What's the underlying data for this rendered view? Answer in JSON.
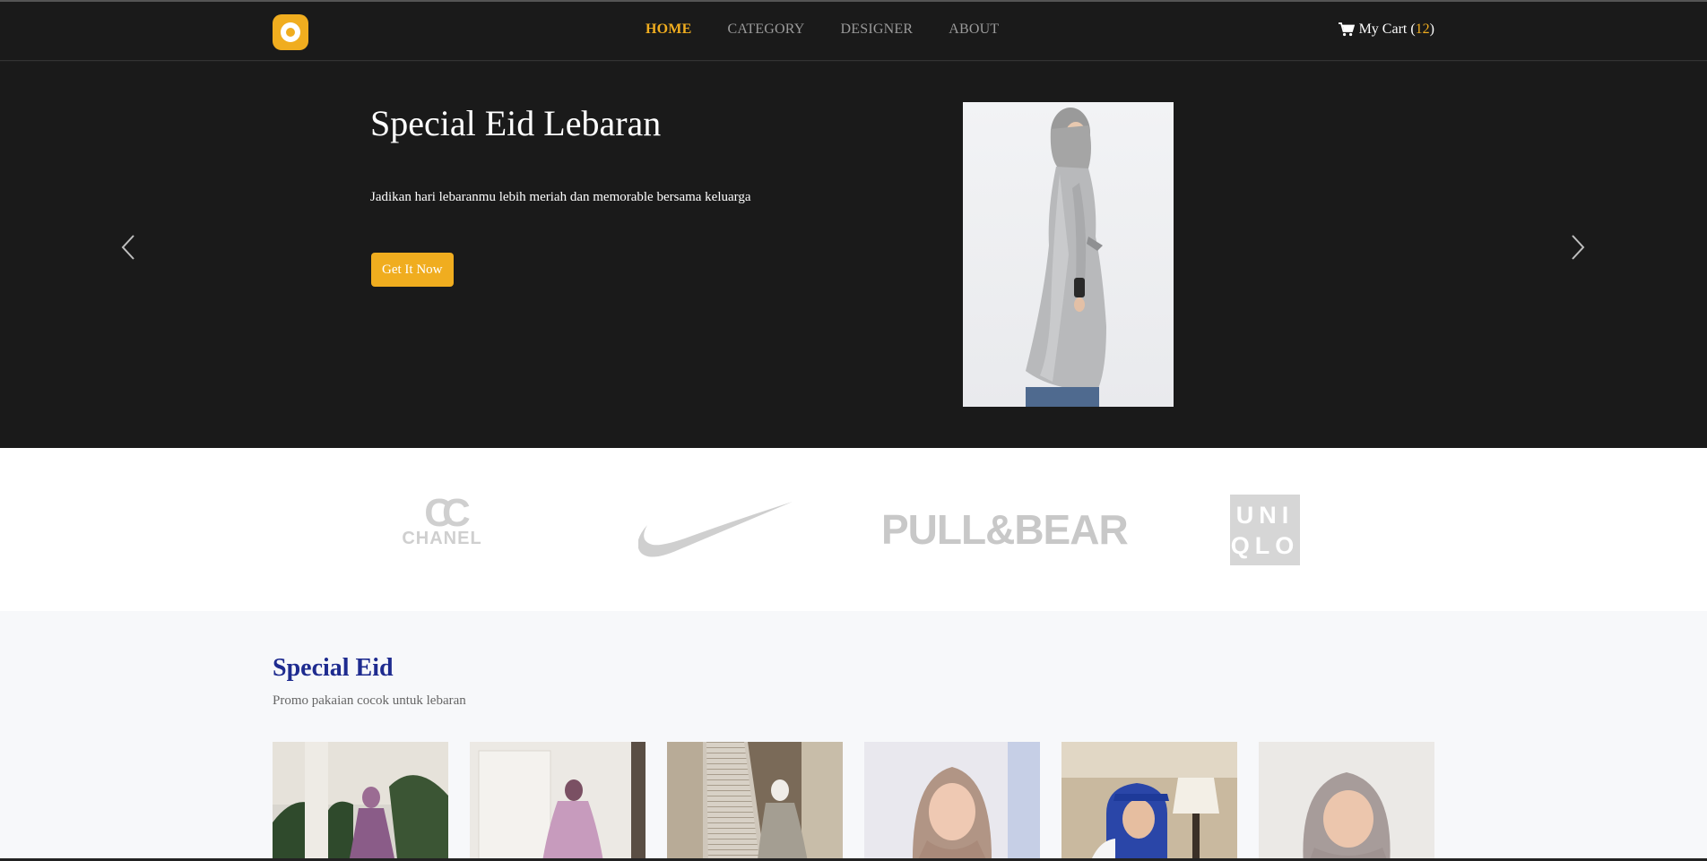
{
  "nav": {
    "links": [
      {
        "label": "HOME",
        "active": true
      },
      {
        "label": "CATEGORY",
        "active": false
      },
      {
        "label": "DESIGNER",
        "active": false
      },
      {
        "label": "ABOUT",
        "active": false
      }
    ],
    "cart_label": "My Cart (",
    "cart_count": "12",
    "cart_close": ")"
  },
  "hero": {
    "title": "Special Eid Lebaran",
    "subtitle": "Jadikan hari lebaranmu lebih meriah dan memorable bersama keluarga",
    "button": "Get It Now"
  },
  "brands": {
    "chanel_mark": "CC",
    "chanel": "CHANEL",
    "pullbear": "PULL&BEAR",
    "uniqlo_line1": "UNI",
    "uniqlo_line2": "QLO"
  },
  "special": {
    "title": "Special Eid",
    "subtitle": "Promo pakaian cocok untuk lebaran"
  },
  "colors": {
    "accent": "#f0ad1f",
    "dark": "#1a1a1a",
    "heading_blue": "#1e2b8f"
  }
}
